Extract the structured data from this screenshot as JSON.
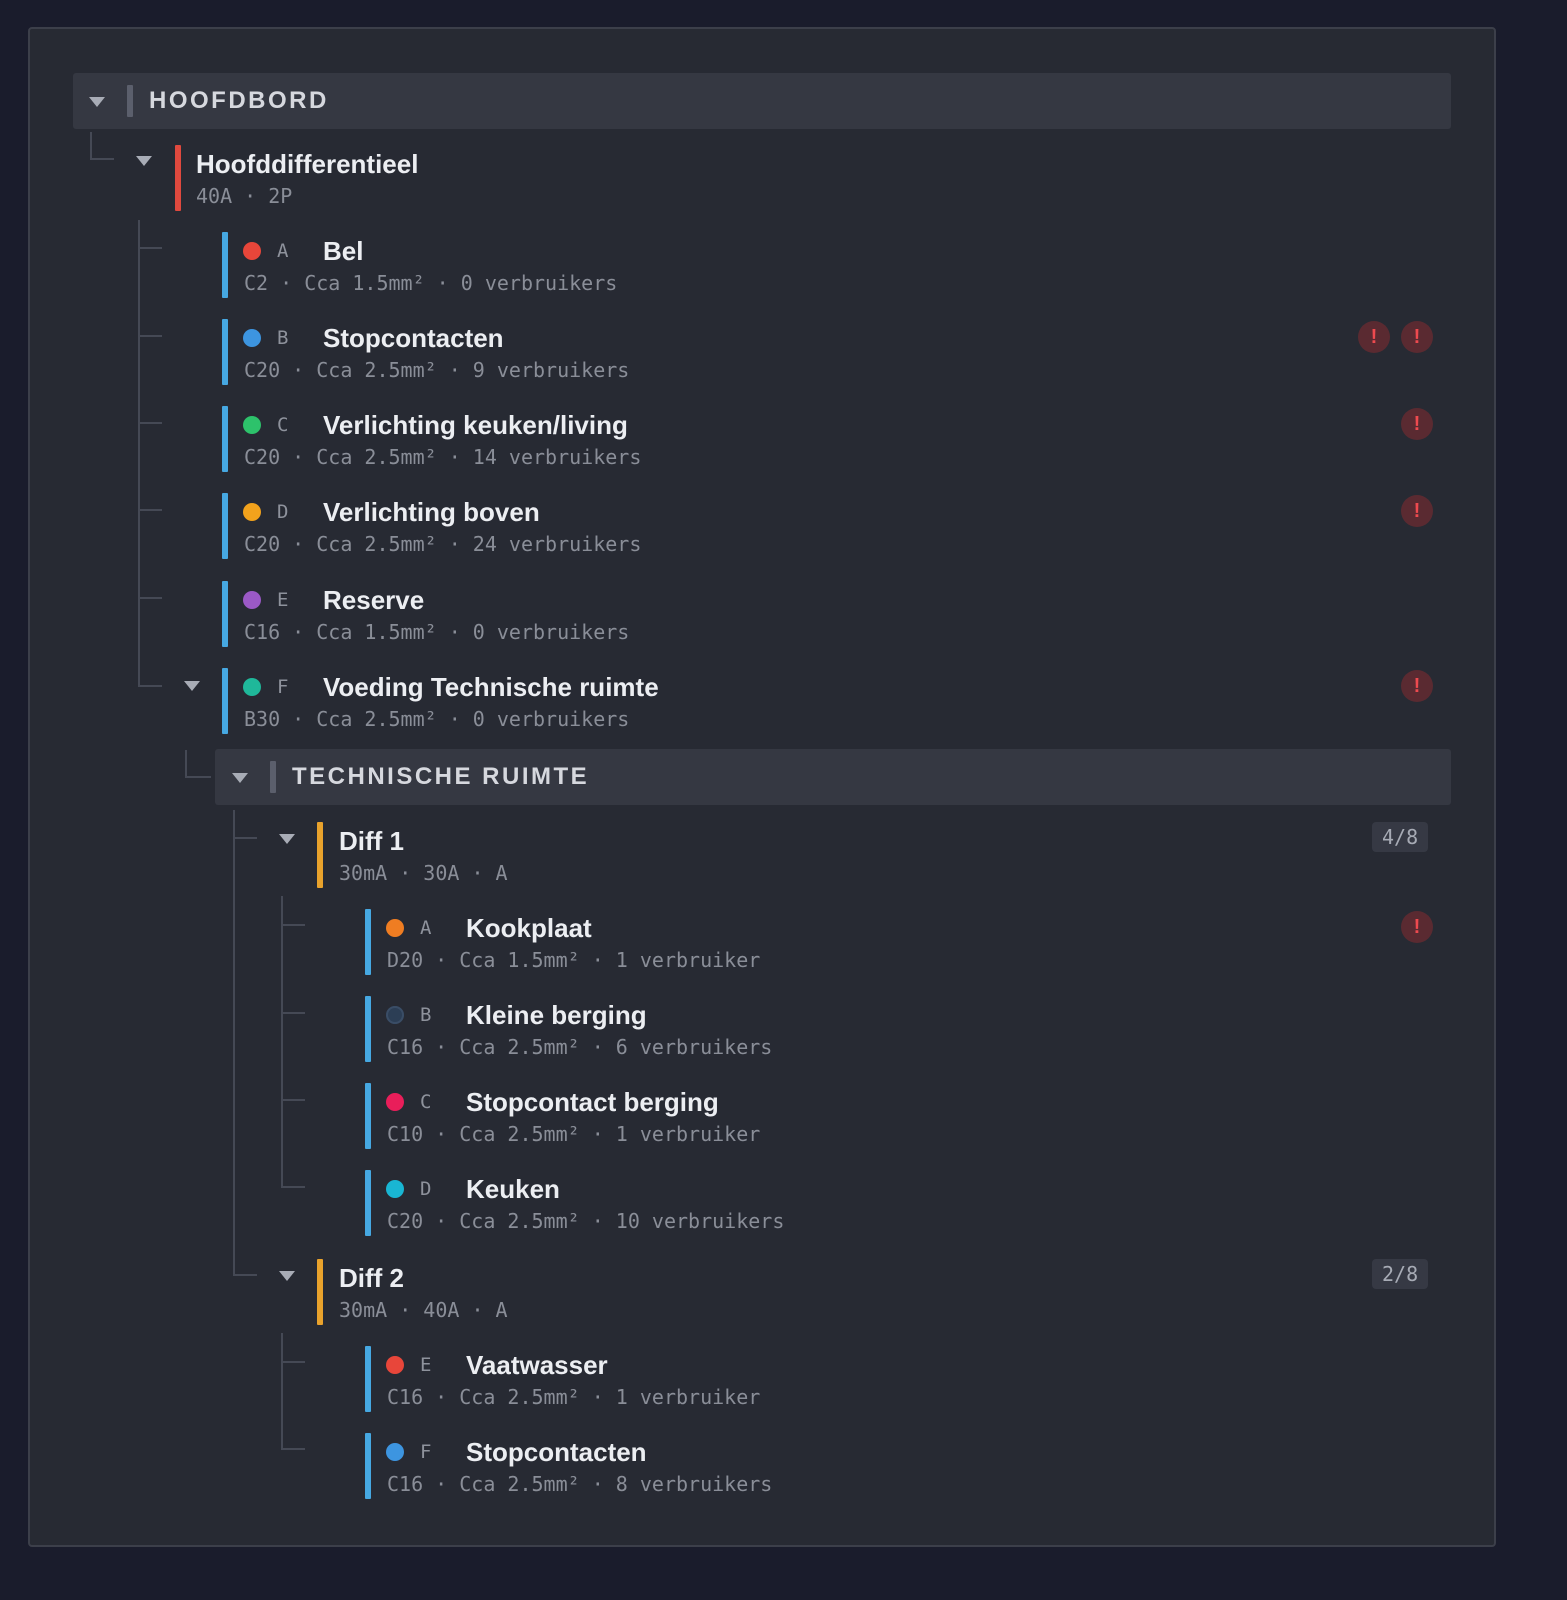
{
  "tree": {
    "board": {
      "title": "HOOFDBORD",
      "main_breaker": {
        "name": "Hoofddifferentieel",
        "meta": "40A · 2P",
        "color": "#e0493e"
      },
      "circuits": [
        {
          "letter": "A",
          "name": "Bel",
          "meta": "C2 · Cca 1.5mm² · 0 verbruikers",
          "dot_color": "#e8463a",
          "warnings": []
        },
        {
          "letter": "B",
          "name": "Stopcontacten",
          "meta": "C20 · Cca 2.5mm² · 9 verbruikers",
          "dot_color": "#3d95e0",
          "warnings": [
            "!",
            "!"
          ]
        },
        {
          "letter": "C",
          "name": "Verlichting keuken/living",
          "meta": "C20 · Cca 2.5mm² · 14 verbruikers",
          "dot_color": "#2dc26b",
          "warnings": [
            "!"
          ]
        },
        {
          "letter": "D",
          "name": "Verlichting boven",
          "meta": "C20 · Cca 2.5mm² · 24 verbruikers",
          "dot_color": "#f2a21c",
          "warnings": [
            "!"
          ]
        },
        {
          "letter": "E",
          "name": "Reserve",
          "meta": "C16 · Cca 1.5mm² · 0 verbruikers",
          "dot_color": "#9b59c6",
          "warnings": []
        },
        {
          "letter": "F",
          "name": "Voeding Technische ruimte",
          "meta": "B30 · Cca 2.5mm² · 0 verbruikers",
          "dot_color": "#1fb89a",
          "warnings": [
            "!"
          ]
        }
      ]
    },
    "sub_board": {
      "title": "TECHNISCHE RUIMTE",
      "diffs": [
        {
          "name": "Diff 1",
          "meta": "30mA · 30A · A",
          "badge": "4/8",
          "color": "#e9a22c",
          "circuits": [
            {
              "letter": "A",
              "name": "Kookplaat",
              "meta": "D20 · Cca 1.5mm² · 1 verbruiker",
              "dot_color": "#ef7d22",
              "warnings": [
                "!"
              ]
            },
            {
              "letter": "B",
              "name": "Kleine berging",
              "meta": "C16 · Cca 2.5mm² · 6 verbruikers",
              "dot_color": "#2c3e55",
              "warnings": []
            },
            {
              "letter": "C",
              "name": "Stopcontact berging",
              "meta": "C10 · Cca 2.5mm² · 1 verbruiker",
              "dot_color": "#e91e5a",
              "warnings": []
            },
            {
              "letter": "D",
              "name": "Keuken",
              "meta": "C20 · Cca 2.5mm² · 10 verbruikers",
              "dot_color": "#19b6d3",
              "warnings": []
            }
          ]
        },
        {
          "name": "Diff 2",
          "meta": "30mA · 40A · A",
          "badge": "2/8",
          "color": "#e9a22c",
          "circuits": [
            {
              "letter": "E",
              "name": "Vaatwasser",
              "meta": "C16 · Cca 2.5mm² · 1 verbruiker",
              "dot_color": "#e8463a",
              "warnings": []
            },
            {
              "letter": "F",
              "name": "Stopcontacten",
              "meta": "C16 · Cca 2.5mm² · 8 verbruikers",
              "dot_color": "#3d95e0",
              "warnings": []
            }
          ]
        }
      ]
    },
    "circuit_bar_color": "#46a8e2",
    "board_bar_color": "#5b5f6c"
  }
}
